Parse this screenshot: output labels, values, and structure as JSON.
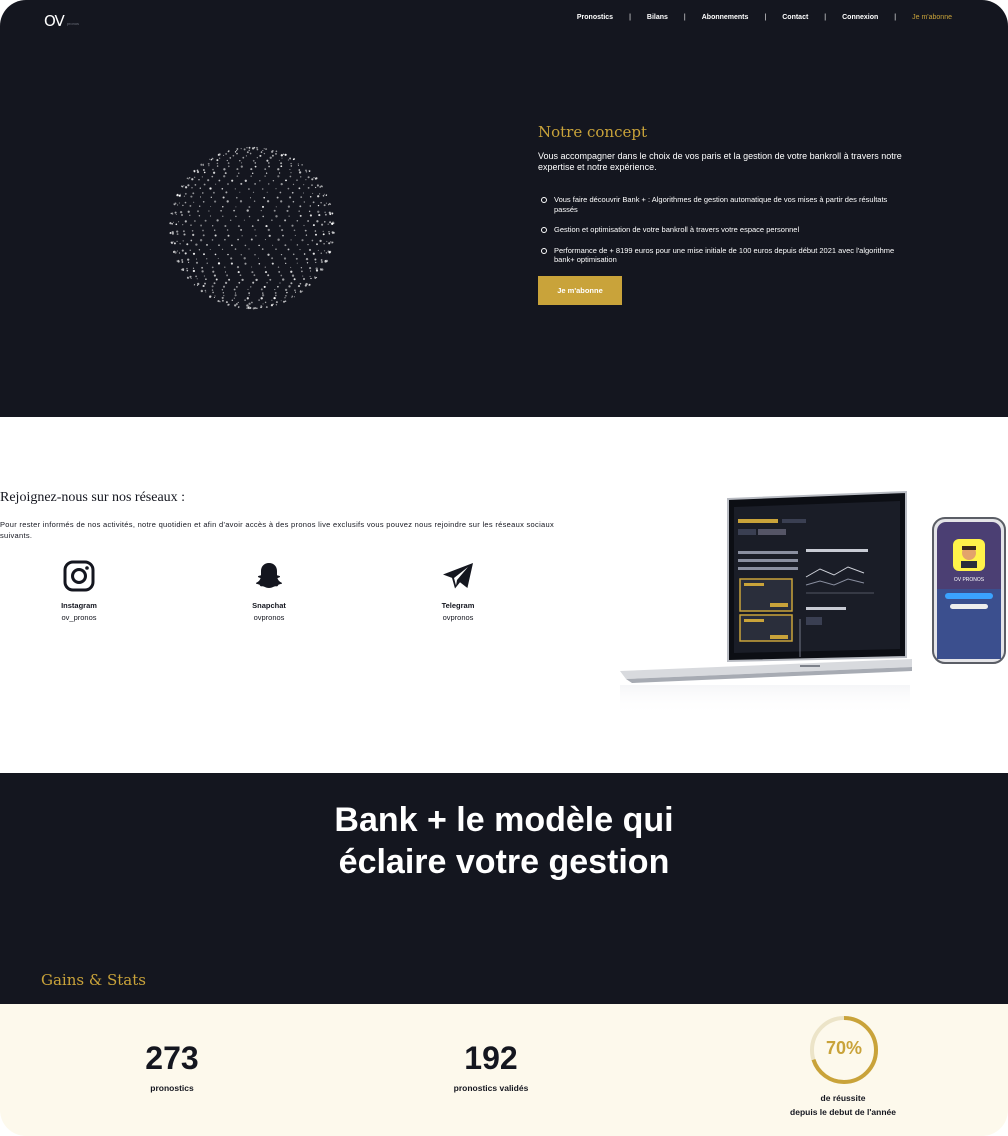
{
  "header": {
    "logo_text": "OV",
    "logo_small": "pronos",
    "nav": [
      {
        "label": "Pronostics"
      },
      {
        "label": "Bilans"
      },
      {
        "label": "Abonnements"
      },
      {
        "label": "Contact"
      },
      {
        "label": "Connexion"
      }
    ],
    "nav_cta": "Je m'abonne",
    "separator": "|"
  },
  "concept": {
    "title": "Notre concept",
    "lead": "Vous accompagner dans le choix de vos paris et la gestion de votre bankroll à travers notre expertise et notre expérience.",
    "items": [
      "Vous faire découvrir Bank + : Algorithmes de gestion automatique de vos mises à partir des résultats passés",
      "Gestion et optimisation de votre bankroll à travers votre espace personnel",
      "Performance de + 8199 euros pour une mise initiale de 100 euros depuis début 2021 avec l'algorithme bank+ optimisation"
    ],
    "cta": "Je m'abonne"
  },
  "social": {
    "title": "Rejoignez-nous sur nos réseaux :",
    "text": "Pour rester informés de nos activités, notre quotidien et afin d'avoir accès à des pronos live exclusifs vous pouvez nous rejoindre sur les réseaux sociaux suivants.",
    "networks": [
      {
        "name": "Instagram",
        "handle": "ov_pronos",
        "icon": "instagram-icon"
      },
      {
        "name": "Snapchat",
        "handle": "ovpronos",
        "icon": "snapchat-icon"
      },
      {
        "name": "Telegram",
        "handle": "ovpronos",
        "icon": "telegram-icon"
      }
    ],
    "phone_label": "OV PRONOS"
  },
  "bank": {
    "title": "Bank + le modèle qui\néclaire votre gestion",
    "gains_title": "Gains & Stats"
  },
  "stats": {
    "pronostics": {
      "value": "273",
      "label": "pronostics"
    },
    "valides": {
      "value": "192",
      "label": "pronostics validés"
    },
    "reussite": {
      "value": "70%",
      "fraction": 0.7,
      "label": "de réussite",
      "sublabel": "depuis le debut de l'année"
    }
  },
  "colors": {
    "dark": "#14161f",
    "gold": "#c9a33a",
    "cream": "#fdf9ec"
  }
}
